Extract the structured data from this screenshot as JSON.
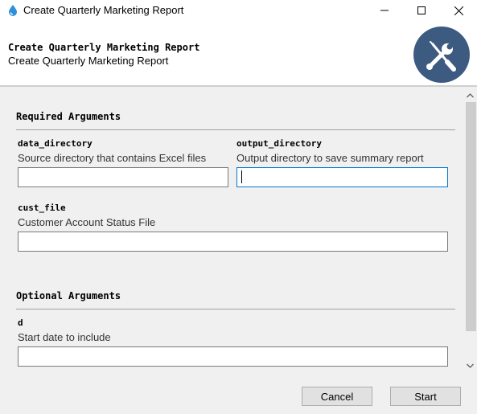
{
  "window": {
    "title": "Create Quarterly Marketing Report",
    "icon": "app-drop-icon",
    "controls": [
      "minimize-icon",
      "maximize-icon",
      "close-icon"
    ]
  },
  "header": {
    "title": "Create Quarterly Marketing Report",
    "subtitle": "Create Quarterly Marketing Report",
    "icon": "tools-icon",
    "icon_color": "#3d5a80"
  },
  "required": {
    "heading": "Required Arguments",
    "args": [
      {
        "name": "data_directory",
        "help": "Source directory that contains Excel files",
        "value": ""
      },
      {
        "name": "output_directory",
        "help": "Output directory to save summary report",
        "value": ""
      },
      {
        "name": "cust_file",
        "help": "Customer Account Status File",
        "value": ""
      }
    ]
  },
  "optional": {
    "heading": "Optional Arguments",
    "args": [
      {
        "name": "d",
        "help": "Start date to include",
        "value": ""
      }
    ]
  },
  "footer": {
    "cancel_label": "Cancel",
    "start_label": "Start"
  },
  "colors": {
    "focus_border": "#0078d7",
    "panel_bg": "#f0f0f0"
  }
}
